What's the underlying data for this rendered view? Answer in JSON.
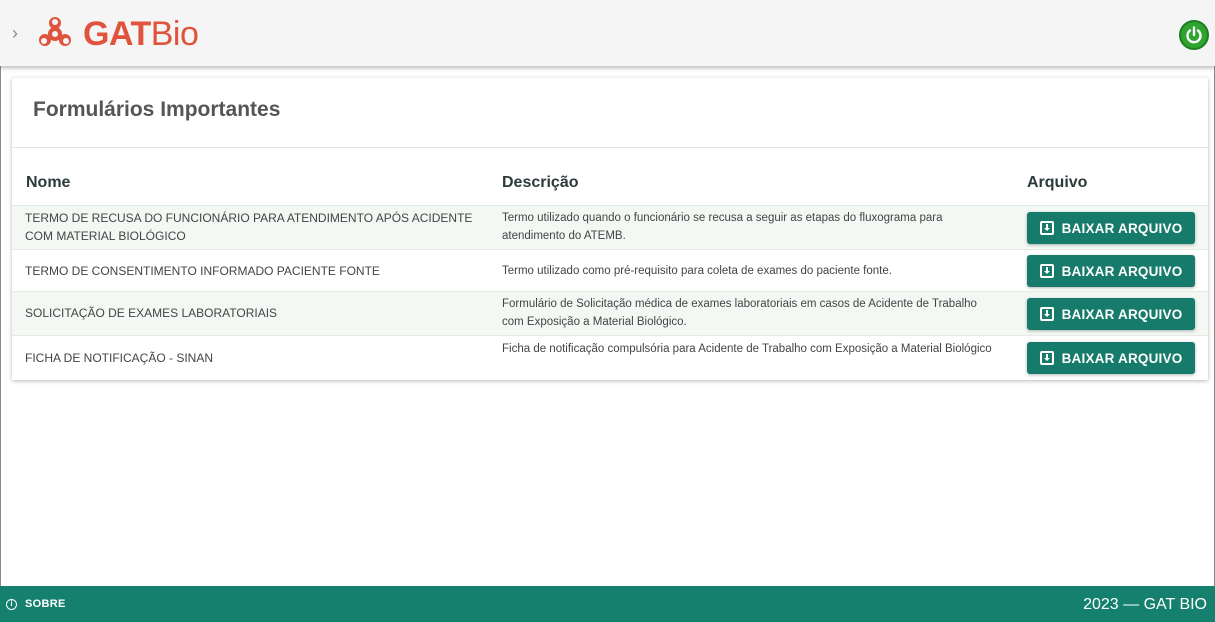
{
  "header": {
    "brand_strong": "GAT",
    "brand_light": "Bio",
    "menu_glyph": "›"
  },
  "colors": {
    "brand": "#e0533d",
    "accent": "#167b6a",
    "footer": "#14806d",
    "power": "#2fa52f"
  },
  "icons": {
    "menu": "chevron-right-icon",
    "logo": "biohazard-logo",
    "power": "power-icon",
    "download": "download-icon",
    "info": "info-icon"
  },
  "main": {
    "title": "Formulários Importantes",
    "columns": {
      "name": "Nome",
      "description": "Descrição",
      "file": "Arquivo"
    },
    "rows": [
      {
        "name": "TERMO DE RECUSA DO FUNCIONÁRIO PARA ATENDIMENTO APÓS ACIDENTE COM MATERIAL BIOLÓGICO",
        "description": "Termo utilizado quando o funcionário se recusa a seguir as etapas do fluxograma para atendimento do ATEMB.",
        "button": "BAIXAR ARQUIVO"
      },
      {
        "name": "TERMO DE CONSENTIMENTO INFORMADO PACIENTE FONTE",
        "description": "Termo utilizado como pré-requisito para coleta de exames do paciente fonte.",
        "button": "BAIXAR ARQUIVO"
      },
      {
        "name": "SOLICITAÇÃO DE EXAMES LABORATORIAIS",
        "description": "Formulário de Solicitação médica de exames laboratoriais em casos de Acidente de Trabalho com Exposição a Material Biológico.",
        "button": "BAIXAR ARQUIVO"
      },
      {
        "name": "FICHA DE NOTIFICAÇÃO - SINAN",
        "description": "Ficha de notificação compulsória para Acidente de Trabalho com Exposição a Material Biológico",
        "button": "BAIXAR ARQUIVO"
      }
    ]
  },
  "footer": {
    "about_label": "SOBRE",
    "copyright": "2023 — GAT BIO"
  }
}
